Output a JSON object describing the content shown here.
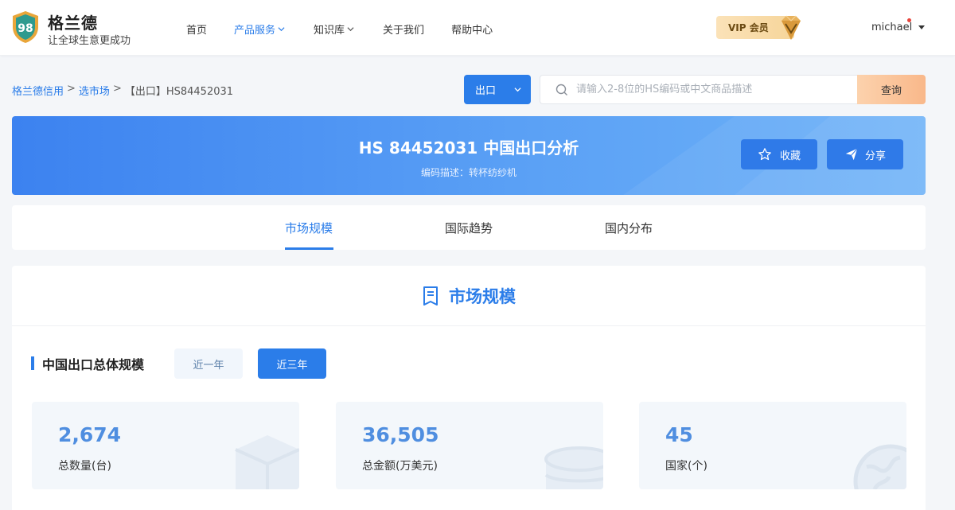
{
  "header": {
    "brand": "格兰德",
    "slogan": "让全球生意更成功",
    "nav": [
      {
        "label": "首页"
      },
      {
        "label": "产品服务"
      },
      {
        "label": "知识库"
      },
      {
        "label": "关于我们"
      },
      {
        "label": "帮助中心"
      }
    ],
    "vip_label": "VIP 会员",
    "username": "michael"
  },
  "breadcrumb": {
    "item1": "格兰德信用",
    "sep": ">",
    "item2": "选市场",
    "current": "【出口】HS84452031"
  },
  "search": {
    "type_value": "出口",
    "placeholder": "请输入2-8位的HS编码或中文商品描述",
    "button_label": "查询"
  },
  "banner": {
    "title": "HS 84452031 中国出口分析",
    "desc_label": "编码描述：",
    "desc_value": "转杯纺纱机",
    "favorite_label": "收藏",
    "share_label": "分享"
  },
  "tabs": [
    {
      "label": "市场规模",
      "active": true
    },
    {
      "label": "国际趋势",
      "active": false
    },
    {
      "label": "国内分布",
      "active": false
    }
  ],
  "section": {
    "title": "市场规模",
    "subtitle": "中国出口总体规模",
    "period_1y": "近一年",
    "period_3y": "近三年"
  },
  "stats": [
    {
      "value": "2,674",
      "label": "总数量(台)",
      "icon": "box-icon"
    },
    {
      "value": "36,505",
      "label": "总金额(万美元)",
      "icon": "coins-icon"
    },
    {
      "value": "45",
      "label": "国家(个)",
      "icon": "globe-icon"
    }
  ],
  "colors": {
    "accent": "#2b7de9",
    "banner_start": "#3c82f0",
    "banner_end": "#6fb3f8",
    "vip_gold": "#f6d59a"
  }
}
